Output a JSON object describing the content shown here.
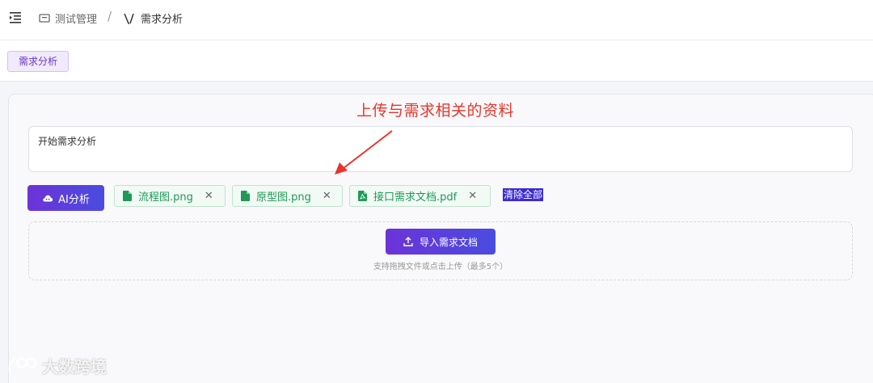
{
  "breadcrumb": {
    "items": [
      "测试管理",
      "需求分析"
    ],
    "separator": "/"
  },
  "tabs": [
    {
      "label": "需求分析",
      "active": true
    }
  ],
  "annotation": {
    "text": "上传与需求相关的资料",
    "color": "#e8342a"
  },
  "prompt": {
    "value": "开始需求分析"
  },
  "ai_button": {
    "label": "AI分析"
  },
  "files": [
    {
      "name": "流程图.png",
      "icon": "image-file-icon"
    },
    {
      "name": "原型图.png",
      "icon": "image-file-icon"
    },
    {
      "name": "接口需求文档.pdf",
      "icon": "pdf-file-icon"
    }
  ],
  "clear_all": {
    "label": "清除全部"
  },
  "upload": {
    "button_label": "导入需求文档",
    "hint": "支持拖拽文件或点击上传（最多5个）"
  },
  "watermark": {
    "text": "大数跨境"
  },
  "colors": {
    "accent": "#6c33d8",
    "file_chip": "#1e9a56",
    "annotation": "#e8342a"
  }
}
